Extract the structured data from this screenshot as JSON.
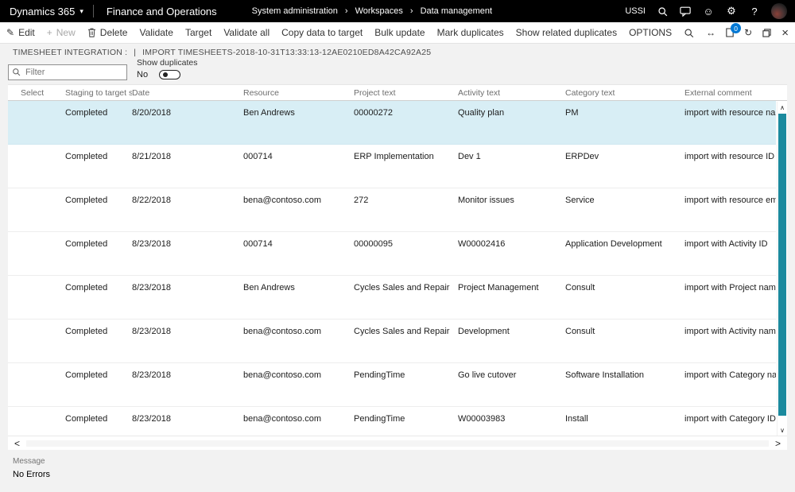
{
  "topbar": {
    "brand": "Dynamics 365",
    "product": "Finance and Operations",
    "breadcrumb": [
      "System administration",
      "Workspaces",
      "Data management"
    ],
    "company": "USSI"
  },
  "actionbar": {
    "buttons": [
      {
        "label": "Edit"
      },
      {
        "label": "New"
      },
      {
        "label": "Delete"
      },
      {
        "label": "Validate"
      },
      {
        "label": "Target"
      },
      {
        "label": "Validate all"
      },
      {
        "label": "Copy data to target"
      },
      {
        "label": "Bulk update"
      },
      {
        "label": "Mark duplicates"
      },
      {
        "label": "Show related duplicates"
      },
      {
        "label": "OPTIONS"
      }
    ],
    "attachment_count": "0"
  },
  "caption": {
    "entity": "TIMESHEET INTEGRATION :",
    "separator": "|",
    "job": "IMPORT TIMESHEETS-2018-10-31T13:33:13-12AE0210ED8A42CA92A25"
  },
  "filter": {
    "placeholder": "Filter"
  },
  "show_duplicates": {
    "label": "Show duplicates",
    "value": "No"
  },
  "grid": {
    "columns": [
      "Select",
      "Staging to target sta...",
      "Date",
      "Resource",
      "Project text",
      "Activity text",
      "Category text",
      "External comment"
    ],
    "rows": [
      {
        "status": "Completed",
        "date": "8/20/2018",
        "resource": "Ben Andrews",
        "project": "00000272",
        "activity": "Quality plan",
        "category": "PM",
        "comment": "import with resource nam"
      },
      {
        "status": "Completed",
        "date": "8/21/2018",
        "resource": "000714",
        "project": "ERP Implementation",
        "activity": "Dev 1",
        "category": "ERPDev",
        "comment": "import with resource ID"
      },
      {
        "status": "Completed",
        "date": "8/22/2018",
        "resource": "bena@contoso.com",
        "project": "272",
        "activity": "Monitor issues",
        "category": "Service",
        "comment": "import with resource ema"
      },
      {
        "status": "Completed",
        "date": "8/23/2018",
        "resource": "000714",
        "project": "00000095",
        "activity": "W00002416",
        "category": "Application Development",
        "comment": "import with Activity ID"
      },
      {
        "status": "Completed",
        "date": "8/23/2018",
        "resource": "Ben Andrews",
        "project": "Cycles Sales and Repair",
        "activity": "Project Management",
        "category": "Consult",
        "comment": "import with Project name"
      },
      {
        "status": "Completed",
        "date": "8/23/2018",
        "resource": "bena@contoso.com",
        "project": "Cycles Sales and Repair",
        "activity": "Development",
        "category": "Consult",
        "comment": "import with Activity name"
      },
      {
        "status": "Completed",
        "date": "8/23/2018",
        "resource": "bena@contoso.com",
        "project": "PendingTime",
        "activity": "Go live cutover",
        "category": "Software Installation",
        "comment": "import with Category nar"
      },
      {
        "status": "Completed",
        "date": "8/23/2018",
        "resource": "bena@contoso.com",
        "project": "PendingTime",
        "activity": "W00003983",
        "category": "Install",
        "comment": "import with Category ID"
      }
    ]
  },
  "footer": {
    "label": "Message",
    "value": "No Errors"
  },
  "icons": {
    "brand_chevron": "▾",
    "breadcrumb_separator": "›",
    "edit": "✎",
    "new": "+",
    "smiley": "☺",
    "gear": "⚙",
    "help": "?",
    "expand": "↔",
    "refresh": "↻",
    "close": "×",
    "scroll_up": "∧",
    "scroll_down": "∨",
    "scroll_left": "<",
    "scroll_right": ">"
  },
  "colors": {
    "accent": "#0078d4",
    "topbar_bg": "#000000",
    "selected_row": "#d8eef5",
    "scrollbar": "#1b8a9e"
  }
}
